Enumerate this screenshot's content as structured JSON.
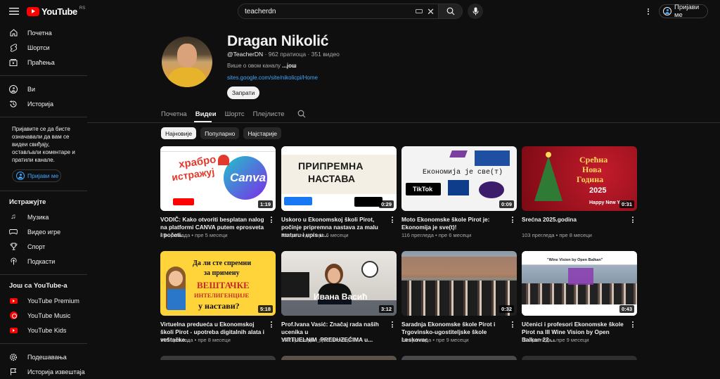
{
  "topbar": {
    "logo_text": "YouTube",
    "logo_country": "RS",
    "search_value": "teacherdn",
    "signin_label": "Пријави ме"
  },
  "sidebar": {
    "items_top": [
      {
        "label": "Почетна",
        "icon": "home-icon"
      },
      {
        "label": "Шортси",
        "icon": "shorts-icon"
      },
      {
        "label": "Праћења",
        "icon": "subscriptions-icon"
      }
    ],
    "items_you": [
      {
        "label": "Ви",
        "icon": "you-icon"
      },
      {
        "label": "Историја",
        "icon": "history-icon"
      }
    ],
    "signin_note": "Пријавите се да бисте означавали да вам се видеи свиђају, остављали коментаре и пратили канале.",
    "signin_label": "Пријави ме",
    "explore_heading": "Истражујте",
    "explore_items": [
      {
        "label": "Музика",
        "icon": "music-icon"
      },
      {
        "label": "Видео игре",
        "icon": "gaming-icon"
      },
      {
        "label": "Спорт",
        "icon": "trophy-icon"
      },
      {
        "label": "Подкасти",
        "icon": "podcast-icon"
      }
    ],
    "more_heading": "Још са YouTube-а",
    "more_items": [
      {
        "label": "YouTube Premium",
        "icon": "youtube-premium-icon"
      },
      {
        "label": "YouTube Music",
        "icon": "youtube-music-icon"
      },
      {
        "label": "YouTube Kids",
        "icon": "youtube-kids-icon"
      }
    ],
    "bottom_items": [
      {
        "label": "Подешавања",
        "icon": "settings-icon"
      },
      {
        "label": "Историја извештаја",
        "icon": "flag-icon"
      }
    ]
  },
  "channel": {
    "name": "Dragan Nikolić",
    "handle": "@TeacherDN",
    "subscribers": "962 пратиоца",
    "videos_count": "351 видео",
    "about_text": "Више о овом каналу",
    "about_more": "...још",
    "link": "sites.google.com/site/nikolicpi/Home",
    "subscribe_label": "Запрати"
  },
  "tabs": [
    {
      "label": "Почетна",
      "active": false
    },
    {
      "label": "Видеи",
      "active": true
    },
    {
      "label": "Шортс",
      "active": false
    },
    {
      "label": "Плејлисте",
      "active": false
    }
  ],
  "chips": [
    {
      "label": "Најновије",
      "active": true
    },
    {
      "label": "Популарно",
      "active": false
    },
    {
      "label": "Најстарије",
      "active": false
    }
  ],
  "videos": [
    {
      "title": "VODIČ: Kako otvoriti besplatan nalog na platformi CANVA putem eprosveta i početi...",
      "views": "35 прегледа",
      "age": "пре 5 месеци",
      "duration": "1:19",
      "thumb_text": [
        "храбро",
        "истражуј",
        "Canva"
      ]
    },
    {
      "title": "Uskoro u Ekonomskoj školi Pirot, počinje pripremna nastava za malu maturu i upis u...",
      "views": "73 прегледа",
      "age": "пре 6 месеци",
      "duration": "0:29",
      "thumb_text": [
        "ПРИПРЕМНА",
        "НАСТАВА"
      ]
    },
    {
      "title": "Moto Ekonomske škole Pirot je: Ekonomija je sve(t)!",
      "views": "116 прегледа",
      "age": "пре 6 месеци",
      "duration": "0:09",
      "thumb_text": [
        "Економија је све(т)",
        "TikTok"
      ]
    },
    {
      "title": "Srećna 2025.godina",
      "views": "103 прегледа",
      "age": "пре 8 месеци",
      "duration": "0:31",
      "thumb_text": [
        "Срећна",
        "Нова",
        "Година",
        "2025",
        "Happy New Year"
      ]
    },
    {
      "title": "Virtuelna predueća u Ekonomskoj školi Pirot - upotreba digitalnih alata i veštačke...",
      "views": "105 прегледа",
      "age": "пре 8 месеци",
      "duration": "5:18",
      "thumb_text": [
        "Да ли сте спремни",
        "за примену",
        "ВЕШТАЧКЕ",
        "ИНТЕЛИГЕНЦИЈЕ",
        "у настави?"
      ]
    },
    {
      "title": "Prof.Ivana Vasić: Značaj rada naših ucenika u VIRTUELNIM_PREDUZEĆIMA u...",
      "views": "168 прегледа",
      "age": "пре 8 месеци",
      "duration": "3:12",
      "thumb_text": [
        "Ивана Васић"
      ]
    },
    {
      "title": "Saradnja Ekonomske škole Pirot i Trgovinsko-ugostiteljske škole Leskovac",
      "views": "96 прегледа",
      "age": "пре 9 месеци",
      "duration": "0:32",
      "thumb_text": []
    },
    {
      "title": "Učenici i profesori Ekonomske škole Pirot na III Wine Vision by Open Balkan 22-...",
      "views": "63 прегледа",
      "age": "пре 9 месеци",
      "duration": "0:43",
      "thumb_text": [
        "\"Wine Vision by Open Balkan\""
      ]
    }
  ]
}
